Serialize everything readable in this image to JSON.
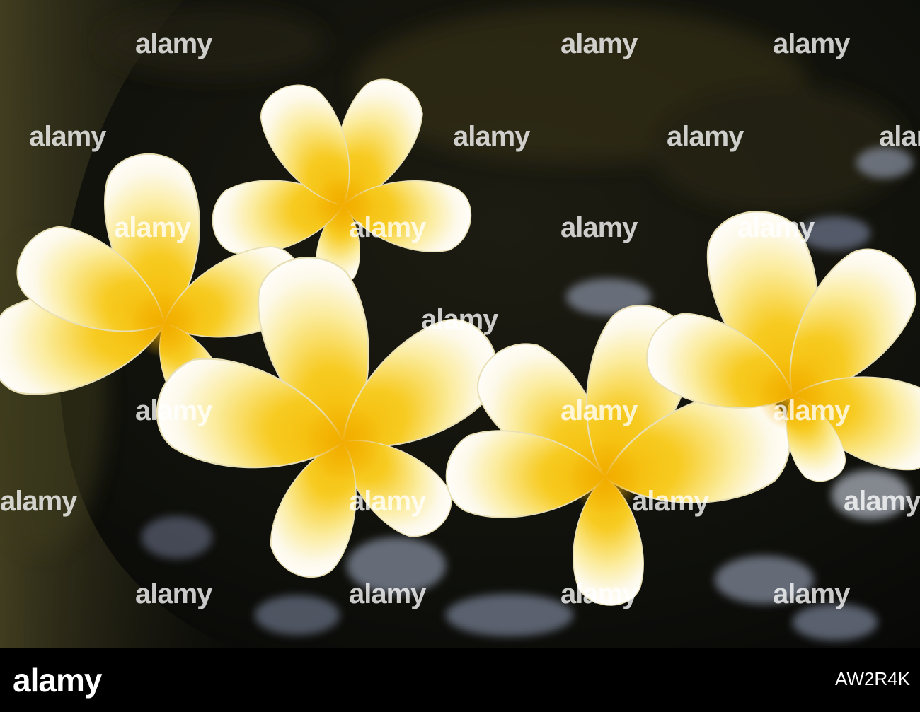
{
  "watermark_text": "alamy",
  "footer": {
    "logo": "alamy",
    "stock_id": "AW2R4K"
  },
  "colors": {
    "water": "#0c0d08",
    "moss": "#3b3a1c",
    "petal_white": "#fbf8ec",
    "petal_yellow": "#f6c20c",
    "reflection": "#8a93a6",
    "footer_bg": "#000000"
  },
  "subject": {
    "flower_count": 5
  }
}
